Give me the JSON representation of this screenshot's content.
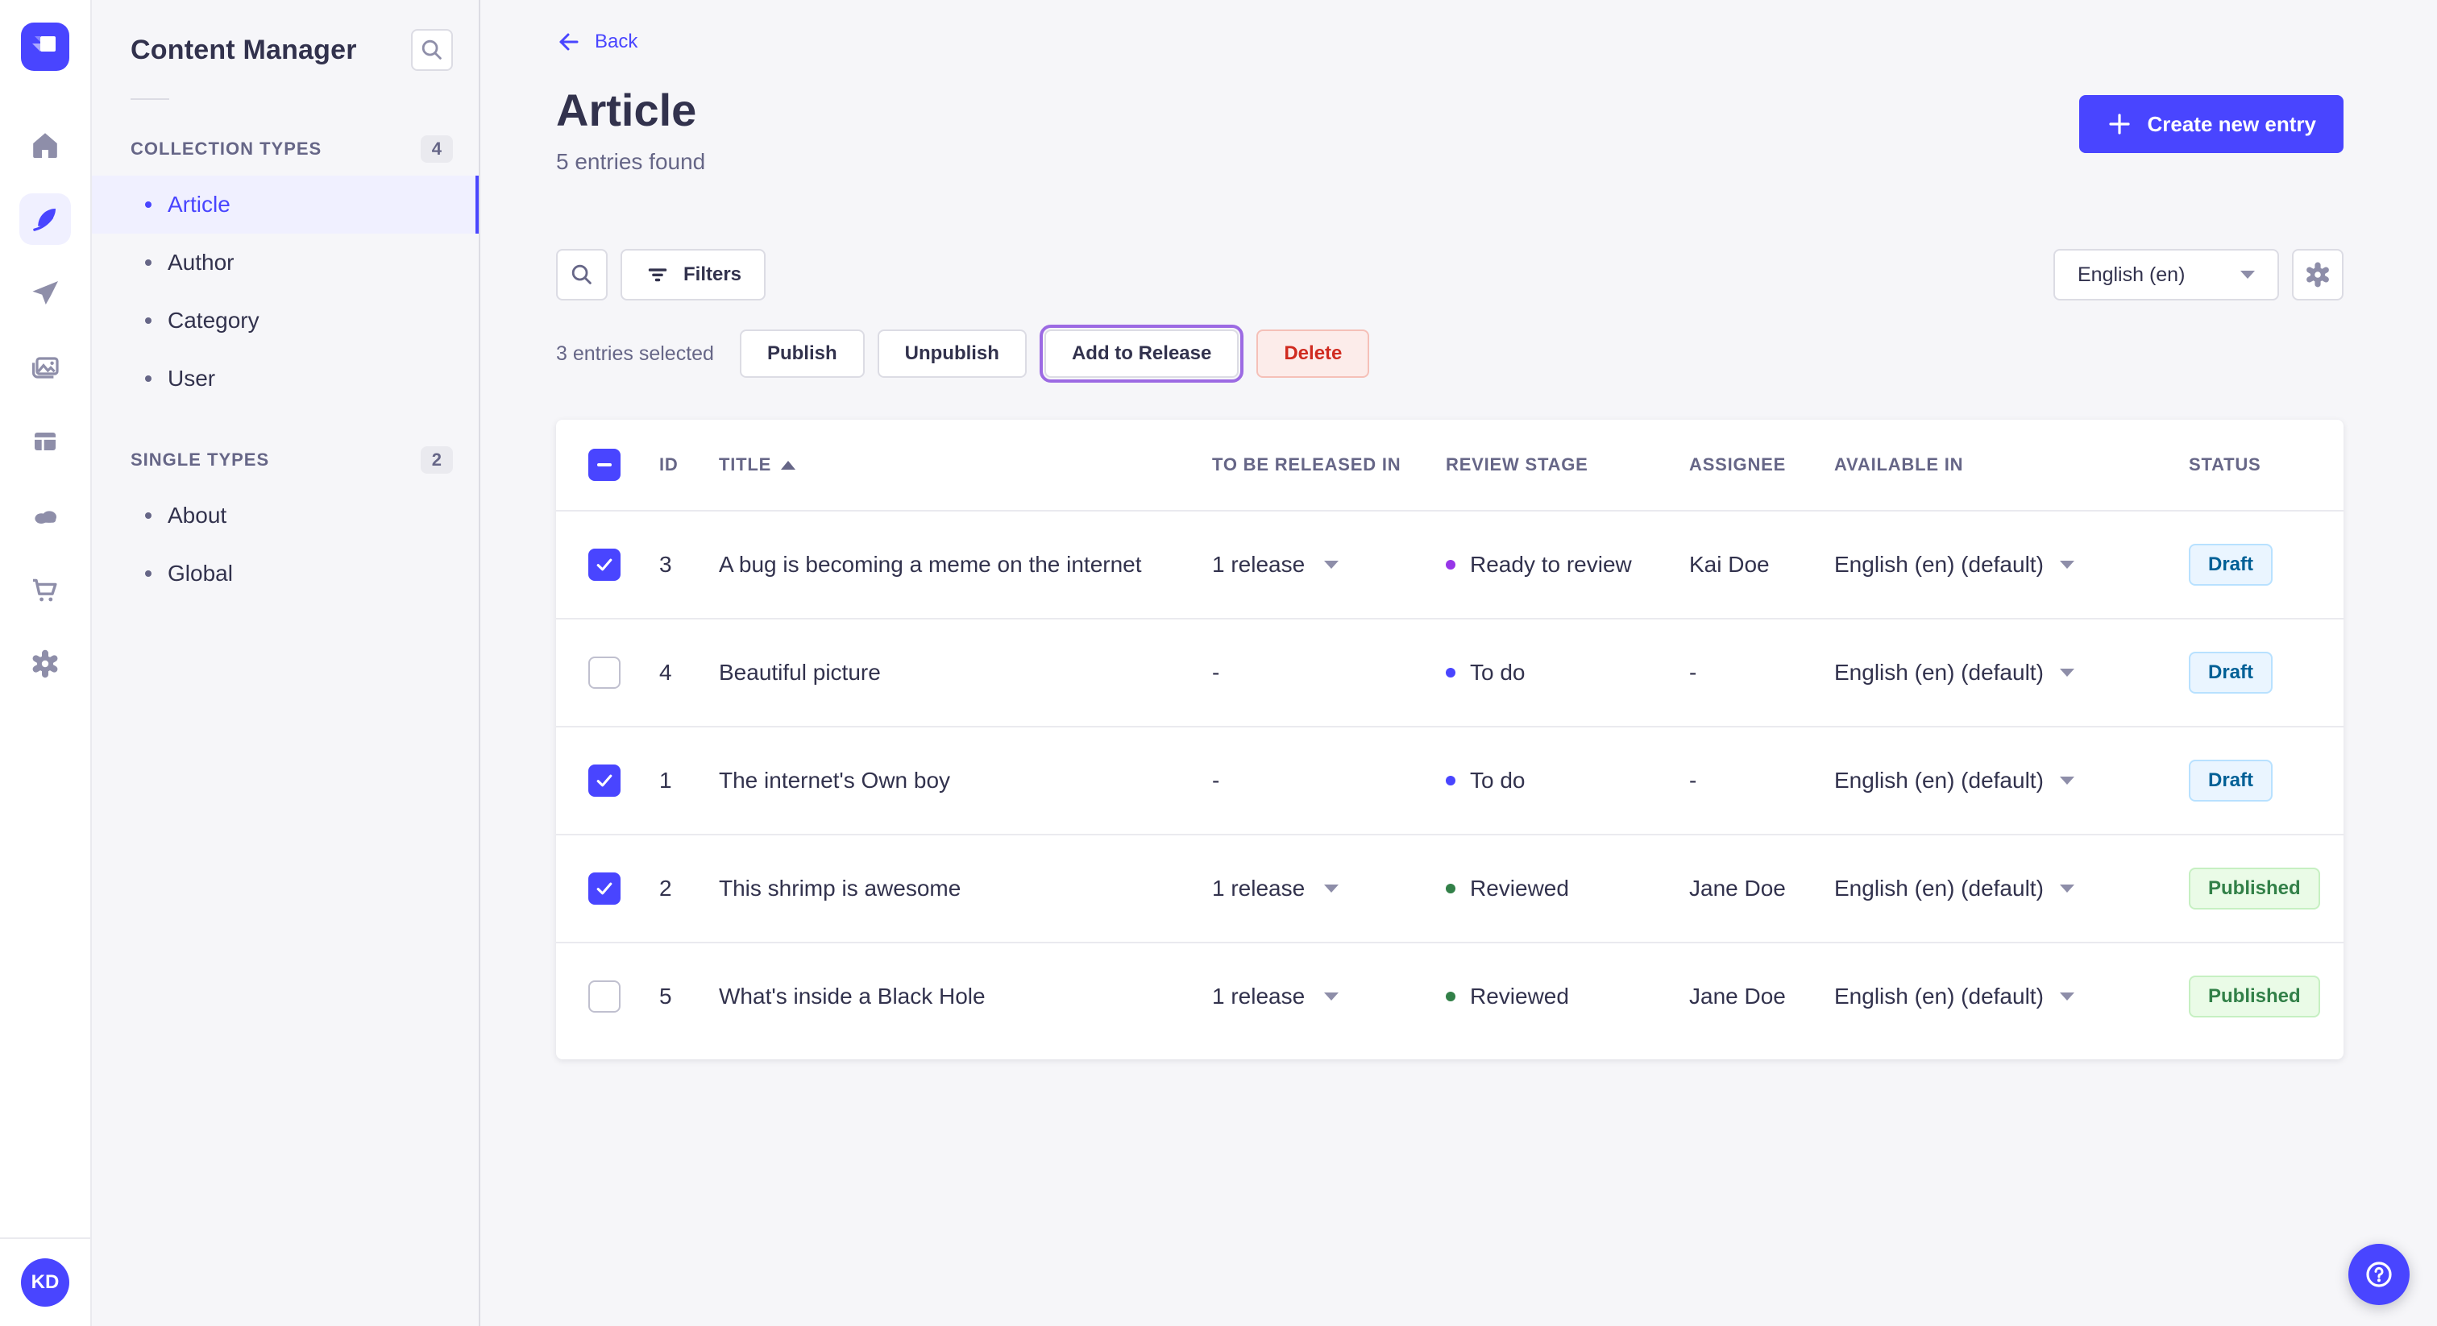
{
  "colors": {
    "primary": "#4945ff",
    "primary_light": "#f0f0ff",
    "danger": "#d02b20",
    "success": "#328048",
    "draft_blue": "#006096",
    "release_outline_purple": "#9c6ae3",
    "stage_ready_to_review": "#9736e8",
    "stage_to_do": "#4945ff",
    "stage_reviewed": "#328048"
  },
  "sidebar": {
    "avatar_initials": "KD",
    "icons": [
      "strapi-logo",
      "home",
      "content-manager",
      "releases",
      "media-library",
      "content-type-builder",
      "deploy-cloud",
      "marketplace",
      "settings"
    ]
  },
  "subnav": {
    "title": "Content Manager",
    "collection_section": {
      "label": "COLLECTION TYPES",
      "badge": "4"
    },
    "collection_items": [
      {
        "label": "Article"
      },
      {
        "label": "Author"
      },
      {
        "label": "Category"
      },
      {
        "label": "User"
      }
    ],
    "single_section": {
      "label": "SINGLE TYPES",
      "badge": "2"
    },
    "single_items": [
      {
        "label": "About"
      },
      {
        "label": "Global"
      }
    ]
  },
  "header": {
    "back_label": "Back",
    "title": "Article",
    "subtitle": "5 entries found",
    "create_button_label": "Create new entry"
  },
  "toolbar": {
    "filters_label": "Filters",
    "locale_value": "English (en)"
  },
  "selection": {
    "text": "3 entries selected",
    "publish_label": "Publish",
    "unpublish_label": "Unpublish",
    "add_to_release_label": "Add to Release",
    "delete_label": "Delete"
  },
  "table": {
    "headers": [
      "ID",
      "TITLE",
      "TO BE RELEASED IN",
      "REVIEW STAGE",
      "ASSIGNEE",
      "AVAILABLE IN",
      "STATUS"
    ],
    "rows": [
      {
        "checked": true,
        "id": "3",
        "title": "A bug is becoming a meme on the internet",
        "release": "1 release",
        "stage": "Ready to review",
        "assignee": "Kai Doe",
        "locale": "English (en) (default)",
        "status": "Draft"
      },
      {
        "checked": false,
        "id": "4",
        "title": "Beautiful picture",
        "release": "-",
        "stage": "To do",
        "assignee": "-",
        "locale": "English (en) (default)",
        "status": "Draft"
      },
      {
        "checked": true,
        "id": "1",
        "title": "The internet's Own boy",
        "release": "-",
        "stage": "To do",
        "assignee": "-",
        "locale": "English (en) (default)",
        "status": "Draft"
      },
      {
        "checked": true,
        "id": "2",
        "title": "This shrimp is awesome",
        "release": "1 release",
        "stage": "Reviewed",
        "assignee": "Jane Doe",
        "locale": "English (en) (default)",
        "status": "Published"
      },
      {
        "checked": false,
        "id": "5",
        "title": "What's inside a Black Hole",
        "release": "1 release",
        "stage": "Reviewed",
        "assignee": "Jane Doe",
        "locale": "English (en) (default)",
        "status": "Published"
      }
    ]
  }
}
